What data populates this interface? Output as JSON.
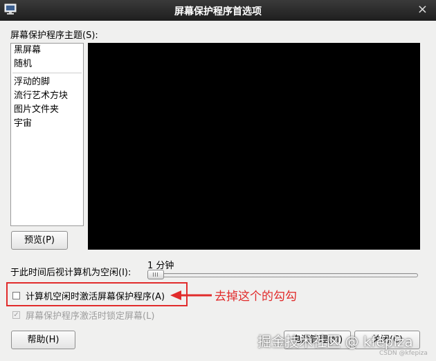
{
  "window": {
    "title": "屏幕保护程序首选项",
    "icon": "display-settings-icon",
    "close": "×"
  },
  "theme": {
    "label": "屏幕保护程序主题(S):",
    "items_top": [
      "黑屏幕",
      "随机"
    ],
    "items_bottom": [
      "浮动的脚",
      "流行艺术方块",
      "图片文件夹",
      "宇宙"
    ]
  },
  "preview_button": "预览(P)",
  "idle": {
    "label": "于此时间后视计算机为空闲(I):",
    "value_text": "1 分钟",
    "slider_fraction": 0.0
  },
  "activate_checkbox": {
    "label": "计算机空闲时激活屏幕保护程序(A)",
    "checked": false
  },
  "lock_checkbox": {
    "label": "屏幕保护程序激活时锁定屏幕(L)",
    "checked": true,
    "disabled": true
  },
  "help_button": "帮助(H)",
  "power_button": "电源管理(M)",
  "close_button": "关闭(C)",
  "annotation": {
    "text": "去掉这个的勾勾",
    "color": "#e12b2b"
  },
  "watermark": {
    "text": "掘金技术社区 @ kfepiza",
    "small": "CSDN @kfepiza"
  }
}
